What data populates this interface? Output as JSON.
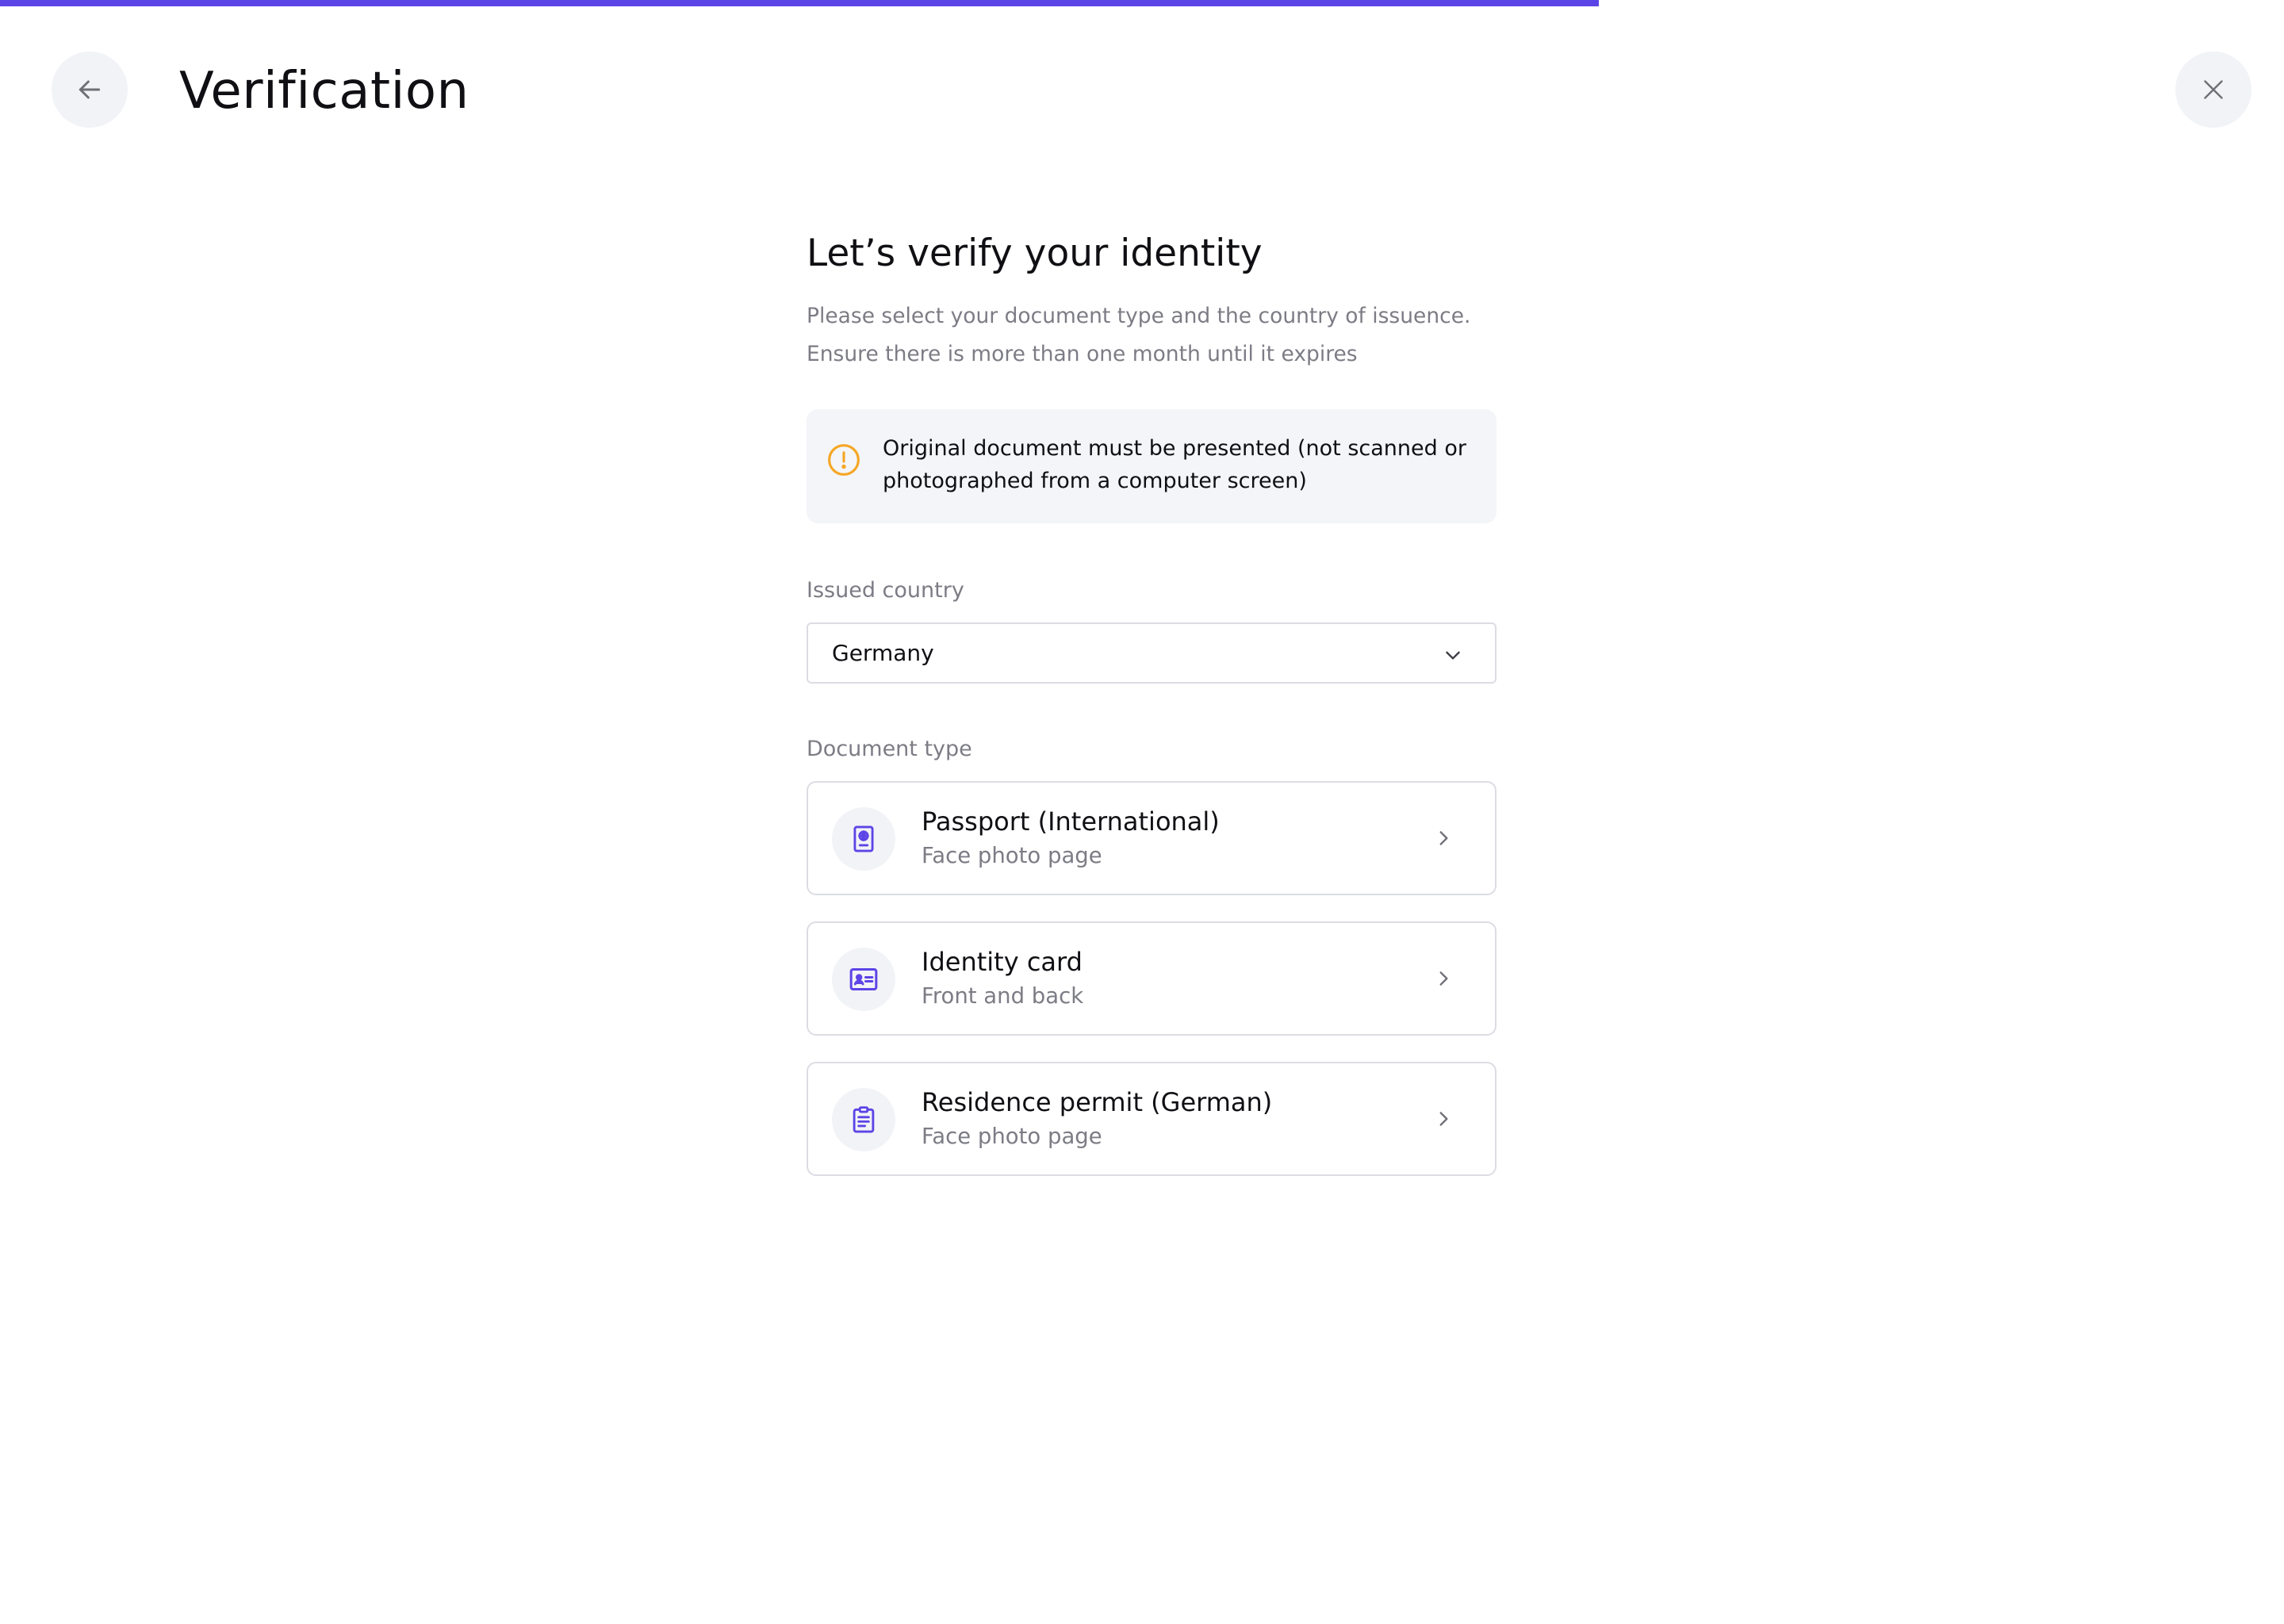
{
  "progress": {
    "percent": 70
  },
  "header": {
    "title": "Verification",
    "back_icon": "arrow-left-icon",
    "close_icon": "close-icon"
  },
  "intro": {
    "heading": "Let’s verify your identity",
    "subtitle_line1": "Please select your document type and the country of issuence.",
    "subtitle_line2": "Ensure there is more than one month until it expires"
  },
  "notice": {
    "icon": "warning-circle-icon",
    "line1": "Original document must be presented (not scanned or",
    "line2": "photographed from a computer screen)"
  },
  "country": {
    "label": "Issued country",
    "selected": "Germany",
    "icon": "chevron-down-icon"
  },
  "documents": {
    "label": "Document type",
    "items": [
      {
        "title": "Passport (International)",
        "subtitle": "Face photo page",
        "icon": "passport-icon"
      },
      {
        "title": "Identity card",
        "subtitle": "Front and back",
        "icon": "id-card-icon"
      },
      {
        "title": "Residence permit (German)",
        "subtitle": "Face photo page",
        "icon": "clipboard-icon"
      }
    ]
  },
  "colors": {
    "accent": "#5b45e6",
    "warning": "#f5a623",
    "muted_text": "#7c7c85",
    "border": "#dcdde3",
    "surface": "#f4f5f8"
  }
}
